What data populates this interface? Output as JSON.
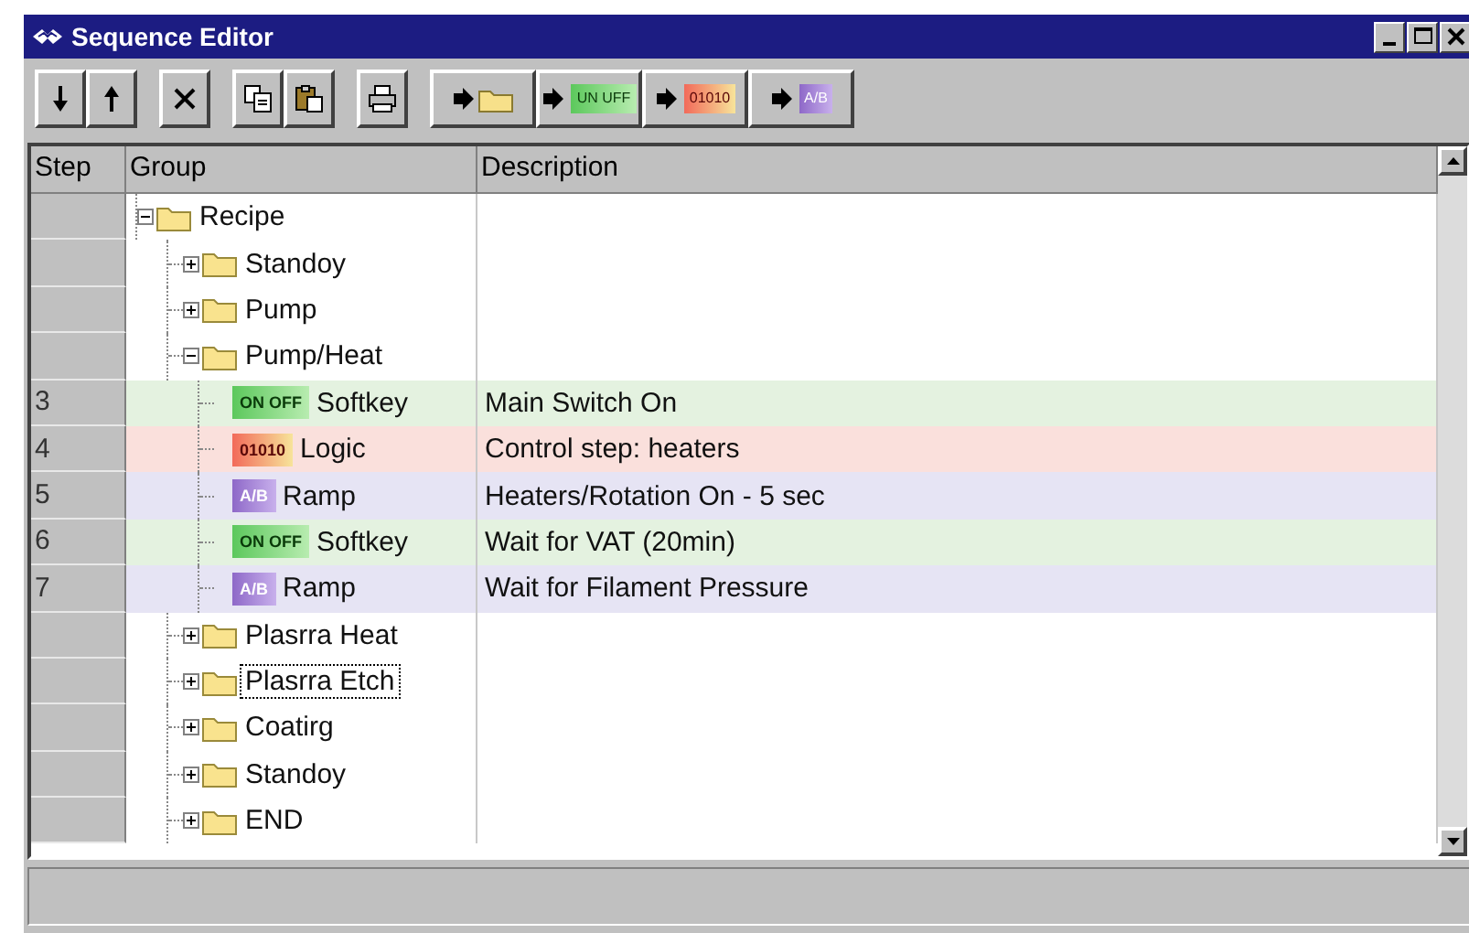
{
  "window": {
    "title": "Sequence Editor"
  },
  "toolbar": {
    "insert_buttons": [
      {
        "kind": "folder"
      },
      {
        "kind": "softkey",
        "badge": "UN UFF"
      },
      {
        "kind": "logic",
        "badge": "01010"
      },
      {
        "kind": "ramp",
        "badge": "A/B"
      }
    ]
  },
  "table": {
    "columns": [
      "Step",
      "Group",
      "Description"
    ],
    "tree": [
      {
        "label": "Recipe",
        "expanded": true,
        "selected": false,
        "children": [
          {
            "label": "Standoy",
            "expanded": false,
            "selected": false
          },
          {
            "label": "Pump",
            "expanded": false,
            "selected": false
          },
          {
            "label": "Pump/Heat",
            "expanded": true,
            "selected": false,
            "children": [
              {
                "kind": "softkey",
                "step": "3",
                "badge": "ON OFF",
                "label": "Softkey",
                "description": "Main Switch On"
              },
              {
                "kind": "logic",
                "step": "4",
                "badge": "01010",
                "label": "Logic",
                "description": "Control step: heaters"
              },
              {
                "kind": "ramp",
                "step": "5",
                "badge": "A/B",
                "label": "Ramp",
                "description": "Heaters/Rotation On - 5 sec"
              },
              {
                "kind": "softkey",
                "step": "6",
                "badge": "ON OFF",
                "label": "Softkey",
                "description": "Wait for VAT (20min)"
              },
              {
                "kind": "ramp",
                "step": "7",
                "badge": "A/B",
                "label": "Ramp",
                "description": "Wait for Filament Pressure"
              }
            ]
          },
          {
            "label": "Plasrra Heat",
            "expanded": false,
            "selected": false
          },
          {
            "label": "Plasrra Etch",
            "expanded": false,
            "selected": true
          },
          {
            "label": "Coatirg",
            "expanded": false,
            "selected": false
          },
          {
            "label": "Standoy",
            "expanded": false,
            "selected": false
          },
          {
            "label": "END",
            "expanded": false,
            "selected": false
          }
        ]
      }
    ]
  }
}
